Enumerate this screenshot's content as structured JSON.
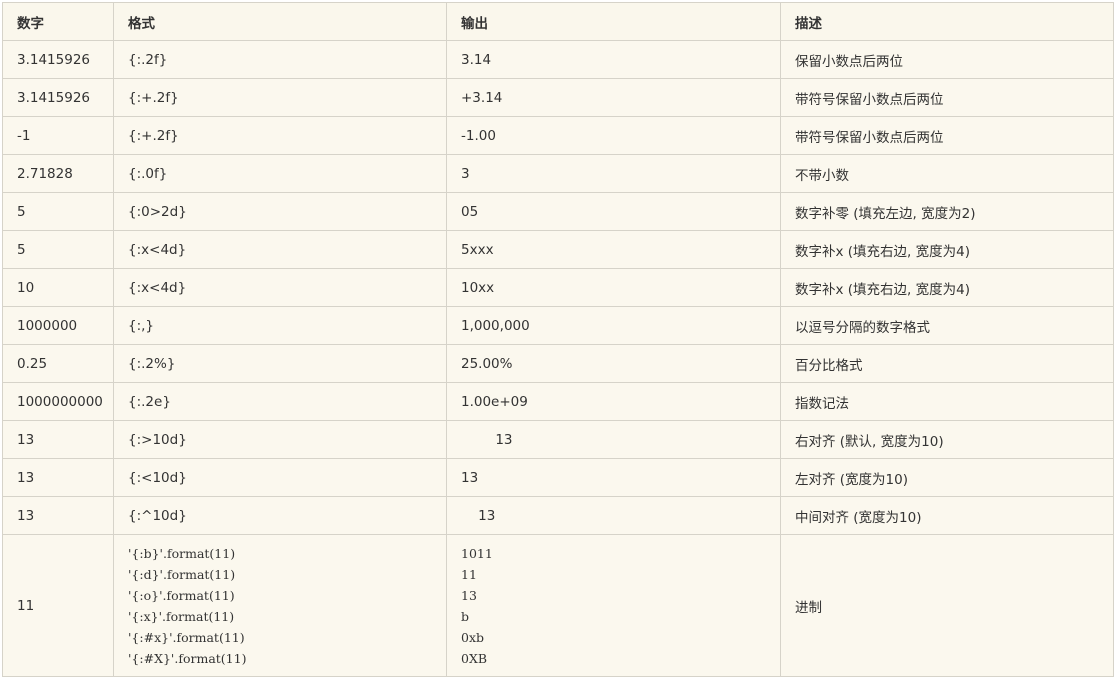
{
  "table": {
    "headers": [
      "数字",
      "格式",
      "输出",
      "描述"
    ],
    "rows": [
      {
        "num": "3.1415926",
        "fmt": "{:.2f}",
        "out": "3.14",
        "desc": "保留小数点后两位"
      },
      {
        "num": "3.1415926",
        "fmt": "{:+.2f}",
        "out": "+3.14",
        "desc": "带符号保留小数点后两位"
      },
      {
        "num": "-1",
        "fmt": "{:+.2f}",
        "out": "-1.00",
        "desc": "带符号保留小数点后两位"
      },
      {
        "num": "2.71828",
        "fmt": "{:.0f}",
        "out": "3",
        "desc": "不带小数"
      },
      {
        "num": "5",
        "fmt": "{:0>2d}",
        "out": "05",
        "desc": "数字补零 (填充左边, 宽度为2)"
      },
      {
        "num": "5",
        "fmt": "{:x<4d}",
        "out": "5xxx",
        "desc": "数字补x (填充右边, 宽度为4)"
      },
      {
        "num": "10",
        "fmt": "{:x<4d}",
        "out": "10xx",
        "desc": "数字补x (填充右边, 宽度为4)"
      },
      {
        "num": "1000000",
        "fmt": "{:,}",
        "out": "1,000,000",
        "desc": "以逗号分隔的数字格式"
      },
      {
        "num": "0.25",
        "fmt": "{:.2%}",
        "out": "25.00%",
        "desc": "百分比格式"
      },
      {
        "num": "1000000000",
        "fmt": "{:.2e}",
        "out": "1.00e+09",
        "desc": "指数记法"
      },
      {
        "num": "13",
        "fmt": "{:>10d}",
        "out": "        13",
        "desc": "右对齐 (默认, 宽度为10)"
      },
      {
        "num": "13",
        "fmt": "{:<10d}",
        "out": "13",
        "desc": "左对齐 (宽度为10)"
      },
      {
        "num": "13",
        "fmt": "{:^10d}",
        "out": "    13",
        "desc": "中间对齐 (宽度为10)"
      }
    ],
    "last_row": {
      "num": "11",
      "fmt_lines": [
        "'{:b}'.format(11)",
        "'{:d}'.format(11)",
        "'{:o}'.format(11)",
        "'{:x}'.format(11)",
        "'{:#x}'.format(11)",
        "'{:#X}'.format(11)"
      ],
      "out_lines": [
        "1011",
        "11",
        "13",
        "b",
        "0xb",
        "0XB"
      ],
      "desc": "进制"
    }
  }
}
